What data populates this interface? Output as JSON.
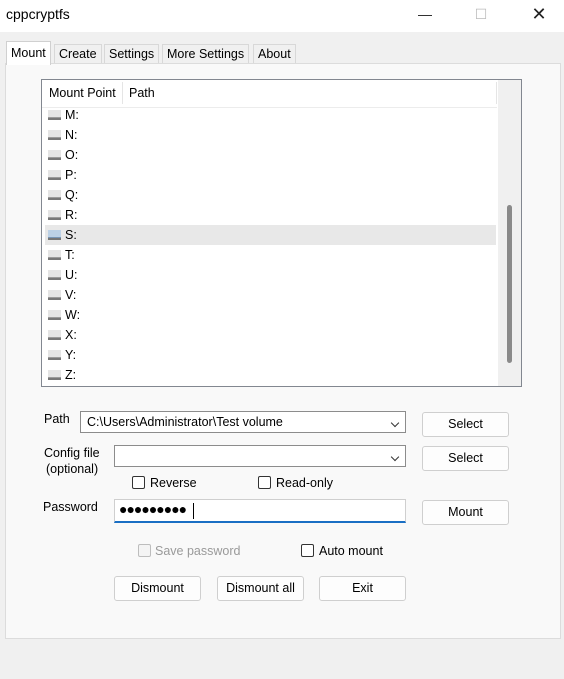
{
  "window": {
    "title": "cppcryptfs",
    "min_glyph": "—",
    "max_glyph": "☐",
    "close_glyph": "✕"
  },
  "tabs": [
    "Mount",
    "Create",
    "Settings",
    "More Settings",
    "About"
  ],
  "list": {
    "columns": [
      "Mount Point",
      "Path"
    ],
    "rows": [
      "M:",
      "N:",
      "O:",
      "P:",
      "Q:",
      "R:",
      "S:",
      "T:",
      "U:",
      "V:",
      "W:",
      "X:",
      "Y:",
      "Z:"
    ],
    "selected_row": "S:",
    "row_icon": "drive-icon"
  },
  "form": {
    "path_label": "Path",
    "path_value": "C:\\Users\\Administrator\\Test volume",
    "path_select": "Select",
    "config_label_1": "Config file",
    "config_label_2": "(optional)",
    "config_value": "",
    "config_select": "Select",
    "reverse": "Reverse",
    "read_only": "Read-only",
    "password_label": "Password",
    "password_mask": "●●●●●●●●●",
    "mount": "Mount",
    "save_password": "Save password",
    "auto_mount": "Auto mount",
    "dismount": "Dismount",
    "dismount_all": "Dismount all",
    "exit": "Exit"
  },
  "colors": {
    "accent": "#1a6fc4",
    "selection": "#e8e8e8"
  }
}
